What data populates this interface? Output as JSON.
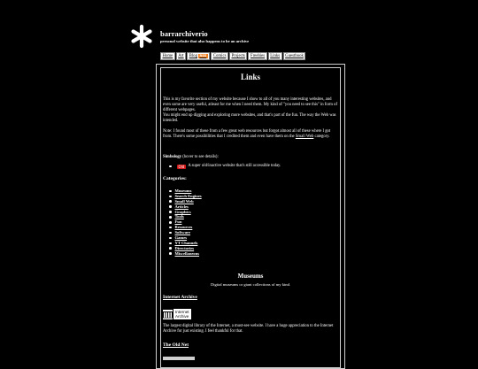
{
  "site": {
    "title": "barrarchiverio",
    "tagline": "personal website that also happens to be an archive"
  },
  "nav": {
    "items": [
      {
        "label": "Home"
      },
      {
        "label": "Art"
      },
      {
        "label": "Blog"
      },
      {
        "label": "Comics"
      },
      {
        "label": "Projects"
      },
      {
        "label": "Freebies"
      },
      {
        "label": "Links"
      },
      {
        "label": "Guestbook"
      }
    ],
    "rss_label": "RSS"
  },
  "page": {
    "heading": "Links",
    "intro_1": "This is my favorite section of my website because I show to all of you many interesting websites, and even some are very useful, atleast for me when I need them. My kind of \"you need to see this\" in form of different webpages.",
    "intro_2": "You might end up digging and exploring more websites, and that's part of the fun. The way the Web was intended.",
    "note_prefix": "Note: I found most of these from a few great web resources but forgot almost all of these where I got from. There's some possibilities that I credited them and even have them on the ",
    "note_link": "Small Web",
    "note_suffix": " category.",
    "simbology_label": "Simbology",
    "simbology_hint": " (hover to see details):",
    "old_badge": "Old",
    "old_text": "A super old/inactive website that's still accessible today."
  },
  "categories": {
    "title": "Categories:",
    "items": [
      "Museums",
      "Search Engines",
      "Small Web",
      "Articles",
      "Graphics",
      "Tools",
      "Fun",
      "Resources",
      "Software",
      "Games",
      "YT Channels",
      "Directories",
      "Miscellaneous"
    ]
  },
  "museums": {
    "title": "Museums",
    "subtitle": "Digital museums or giant collections of my kind.",
    "entry_1": {
      "name": "Internet Archive",
      "logo_text_1": "Internet",
      "logo_text_2": "Archive",
      "desc": "The largest digital library of the Internet, a must-see website. I have a huge appreciation to the Internet Archive for just existing. I feel thankful for that."
    },
    "entry_2": {
      "name": "The Old Net"
    }
  },
  "colors": {
    "background": "#000000",
    "text": "#ffffff",
    "old_badge": "#d31818",
    "rss_badge": "#f48120"
  }
}
